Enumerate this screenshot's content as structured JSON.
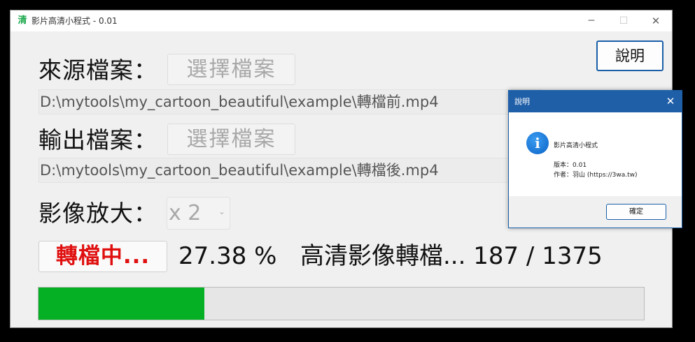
{
  "window": {
    "title": "影片高清小程式 - 0.01",
    "app_icon": "清",
    "minimize_glyph": "─",
    "maximize_glyph": "☐",
    "close_glyph": "✕"
  },
  "source": {
    "label": "來源檔案：",
    "button_label": "選擇檔案",
    "path": "D:\\mytools\\my_cartoon_beautiful\\example\\轉檔前.mp4"
  },
  "output": {
    "label": "輸出檔案：",
    "button_label": "選擇檔案",
    "path": "D:\\mytools\\my_cartoon_beautiful\\example\\轉檔後.mp4"
  },
  "help_button": {
    "label": "說明"
  },
  "scale": {
    "label": "影像放大：",
    "selected": "x 2",
    "chevron": "⌄"
  },
  "convert": {
    "button_label": "轉檔中...",
    "percent_text": "27.38 %",
    "status_text": "高清影像轉檔... 187 / 1375",
    "progress_fraction": 0.2738
  },
  "dialog": {
    "title": "說明",
    "close_glyph": "✕",
    "icon_glyph": "i",
    "app_name": "影片高清小程式",
    "version_line": "版本：0.01",
    "author_line": "作者：羽山 (https://3wa.tw)",
    "ok_label": "確定"
  },
  "colors": {
    "progress_fill": "#06b025",
    "converting_text": "#e01010",
    "dialog_titlebar": "#1f5fa8"
  }
}
